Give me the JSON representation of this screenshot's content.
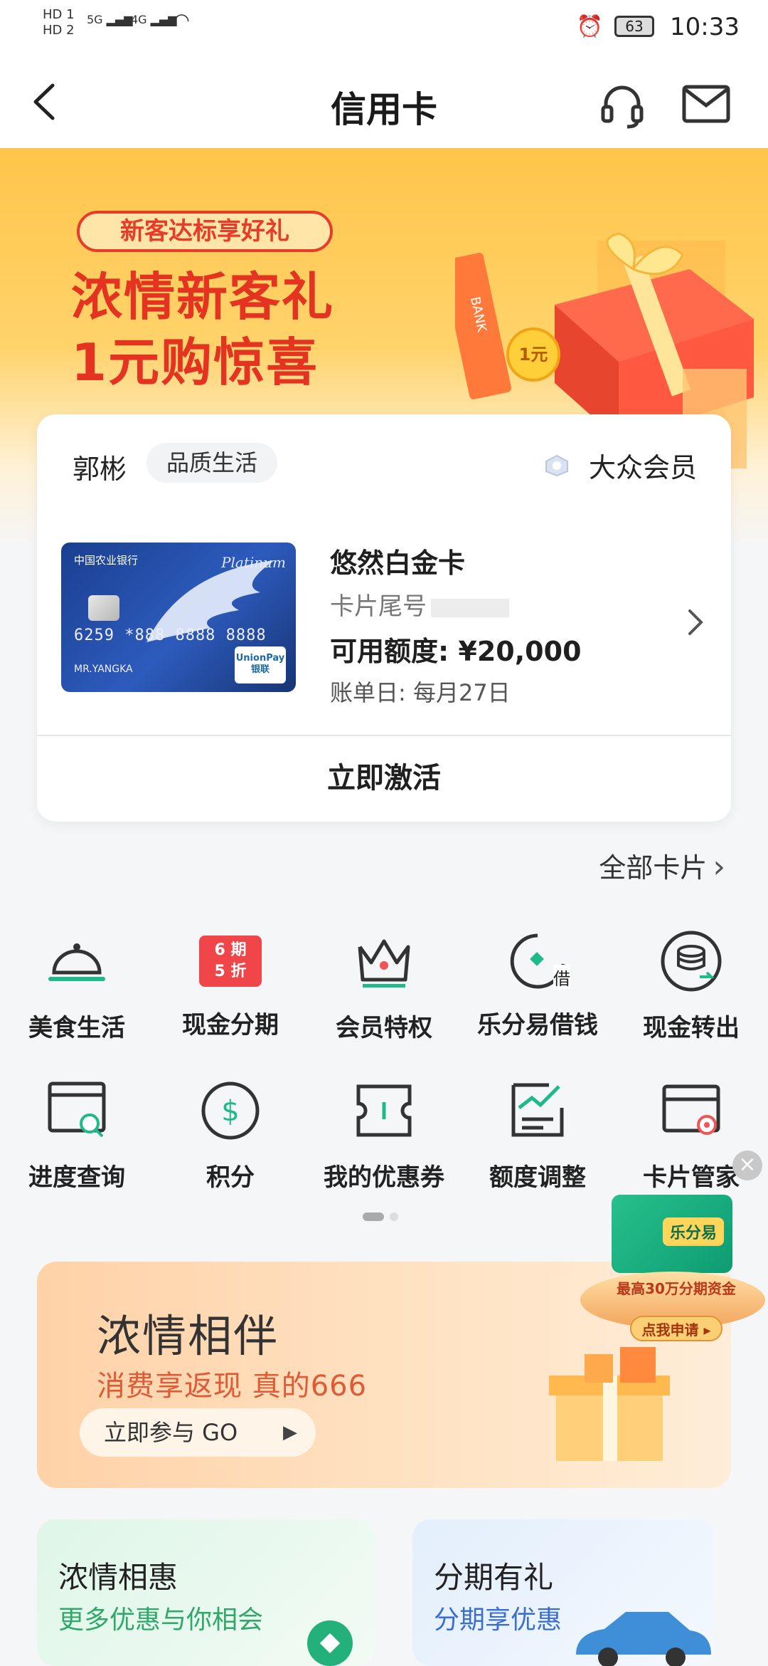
{
  "status_bar": {
    "hd1": "HD 1",
    "hd2": "HD 2",
    "net1": "5G",
    "net2": "4G",
    "battery": "63",
    "time": "10:33"
  },
  "nav": {
    "title": "信用卡",
    "back_icon": "chevron-left-icon",
    "service_icon": "headset-icon",
    "mail_icon": "mail-icon"
  },
  "banner": {
    "tag": "新客达标享好礼",
    "line1": "浓情新客礼",
    "line2": "1元购惊喜",
    "coin": "1元",
    "gift_label": "BANK"
  },
  "card_panel": {
    "user_name": "郭彬",
    "level_tag": "品质生活",
    "member_level": "大众会员",
    "card_name": "悠然白金卡",
    "tail_label": "卡片尾号",
    "limit": "可用额度: ¥20,000",
    "bill_day": "账单日: 每月27日",
    "activate": "立即激活",
    "card_image": {
      "bank": "中国农业银行",
      "tier": "Platinum",
      "number": "6259 *888 8888 8888",
      "holder": "MR.YANGKA",
      "network": "UnionPay\n银联"
    }
  },
  "all_cards": "全部卡片",
  "grid": [
    {
      "label": "美食生活",
      "icon": "cloche-icon"
    },
    {
      "label": "现金分期",
      "icon": "installment-6-5-icon",
      "badge1": "6 期",
      "badge2": "5 折"
    },
    {
      "label": "会员特权",
      "icon": "crown-icon"
    },
    {
      "label": "乐分易借钱",
      "icon": "loan-icon",
      "badge": "借"
    },
    {
      "label": "现金转出",
      "icon": "coin-stack-icon"
    },
    {
      "label": "进度查询",
      "icon": "progress-search-icon"
    },
    {
      "label": "积分",
      "icon": "dollar-circle-icon"
    },
    {
      "label": "我的优惠券",
      "icon": "coupon-icon"
    },
    {
      "label": "额度调整",
      "icon": "limit-chart-icon"
    },
    {
      "label": "卡片管家",
      "icon": "card-settings-icon"
    }
  ],
  "float_ad": {
    "card_label": "乐分易",
    "promo": "最高30万分期资金",
    "cta": "点我申请 ▸"
  },
  "promo": {
    "title": "浓情相伴",
    "subtitle": "消费享返现 真的666",
    "cta": "立即参与 GO"
  },
  "tiles": [
    {
      "title": "浓情相惠",
      "subtitle": "更多优惠与你相会",
      "color": "#2fa86a"
    },
    {
      "title": "分期有礼",
      "subtitle": "分期享优惠",
      "color": "#3a6fd0"
    }
  ]
}
